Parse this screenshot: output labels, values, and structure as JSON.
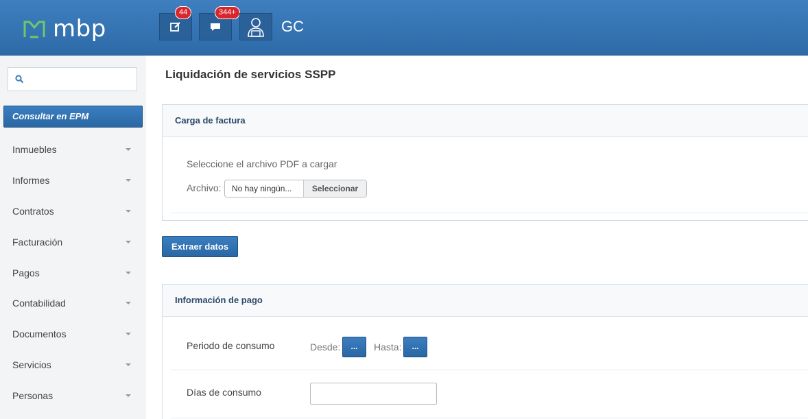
{
  "header": {
    "logo_text": "mbp",
    "notifications": {
      "tasks_count": "44",
      "messages_count": "344+"
    },
    "user_initials": "GC"
  },
  "sidebar": {
    "search": {
      "placeholder": ""
    },
    "primary_action": "Consultar en EPM",
    "items": [
      {
        "label": "Inmuebles"
      },
      {
        "label": "Informes"
      },
      {
        "label": "Contratos"
      },
      {
        "label": "Facturación"
      },
      {
        "label": "Pagos"
      },
      {
        "label": "Contabilidad"
      },
      {
        "label": "Documentos"
      },
      {
        "label": "Servicios"
      },
      {
        "label": "Personas"
      }
    ]
  },
  "main": {
    "title": "Liquidación de servicios SSPP",
    "upload_panel": {
      "heading": "Carga de factura",
      "hint": "Seleccione el archivo PDF a cargar",
      "file_label": "Archivo:",
      "file_value": "No hay ningún...",
      "file_button": "Seleccionar"
    },
    "extract_button": "Extraer datos",
    "payment_panel": {
      "heading": "Información de pago",
      "period_label": "Periodo de consumo",
      "from_label": "Desde:",
      "to_label": "Hasta:",
      "picker_button": "...",
      "days_label": "Días de consumo",
      "days_value": ""
    }
  },
  "colors": {
    "topbar": "#2d6aa8",
    "accent_button": "#2a67a4",
    "badge": "#d9262c",
    "sidebar_bg": "#f2f4f6"
  }
}
